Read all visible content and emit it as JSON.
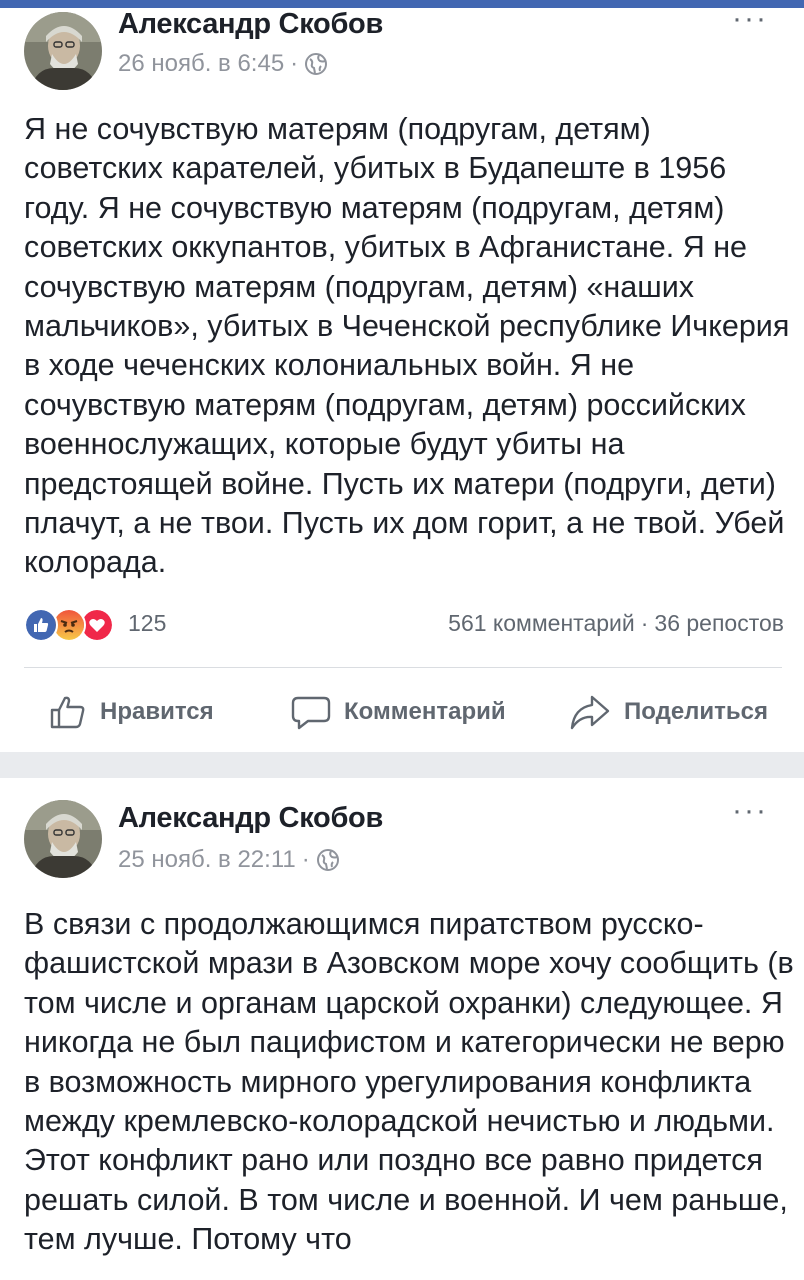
{
  "colors": {
    "brand": "#4267b2",
    "like": "#4267b2",
    "angry": "#f5a623",
    "love": "#f02849",
    "secondary_text": "#90949c",
    "action_text": "#606770"
  },
  "posts": [
    {
      "author": "Александр Скобов",
      "timestamp": "26 нояб. в 6:45",
      "separator": "·",
      "privacy_icon": "globe-icon",
      "more_label": "···",
      "text": "Я не сочувствую матерям (подругам, детям) советских карателей, убитых в Будапеште в 1956 году. Я не сочувствую матерям (подругам, детям) советских оккупантов, убитых в Афганистане. Я не сочувствую матерям (подругам, детям) «наших мальчиков», убитых в Чеченской республике Ичкерия в ходе чеченских колониальных войн. Я не сочувствую матерям (подругам, детям) российских военнослужащих, которые будут убиты на предстоящей войне. Пусть их матери (подруги, дети) плачут, а не твои. Пусть их дом горит, а не твой. Убей колорада.",
      "reactions": {
        "icons": [
          "like-reaction-icon",
          "angry-reaction-icon",
          "love-reaction-icon"
        ],
        "count": "125",
        "comments": "561 комментарий",
        "dot": "·",
        "shares": "36 репостов"
      },
      "actions": {
        "like": "Нравится",
        "comment": "Комментарий",
        "share": "Поделиться"
      }
    },
    {
      "author": "Александр Скобов",
      "timestamp": "25 нояб. в 22:11",
      "separator": "·",
      "privacy_icon": "globe-icon",
      "more_label": "···",
      "text": "В связи с продолжающимся пиратством русско-фашистской мрази в Азовском море хочу сообщить (в том числе и органам царской охранки) следующее. Я никогда не был пацифистом и категорически не верю в возможность мирного урегулирования конфликта между кремлевско-колорадской нечистью и людьми. Этот конфликт рано или поздно все равно придется решать силой. В том числе и военной. И чем раньше, тем лучше. Потому что"
    }
  ]
}
